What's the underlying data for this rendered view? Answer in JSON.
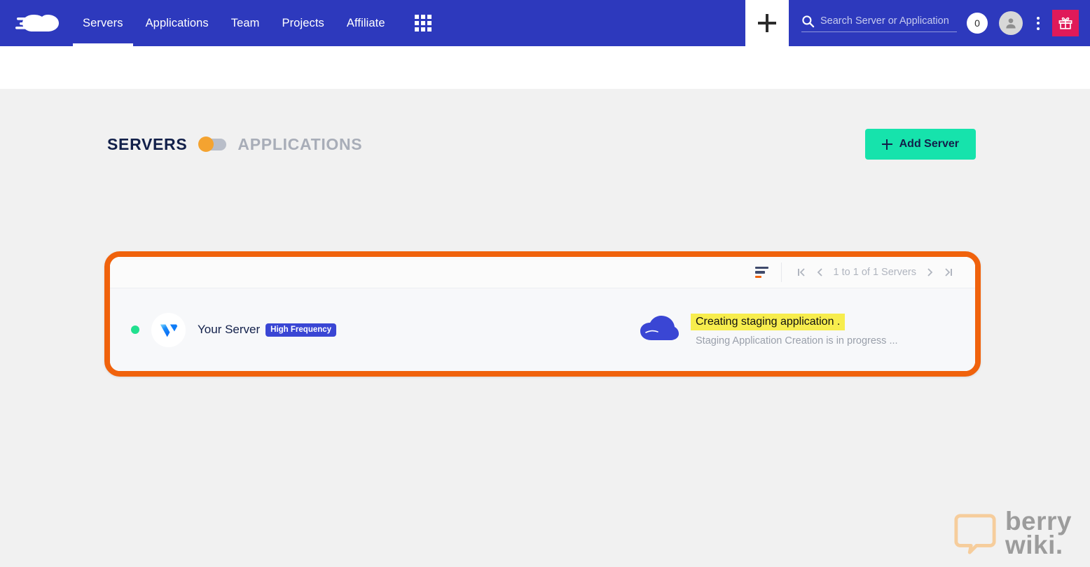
{
  "navbar": {
    "logo_name": "cloudways-logo",
    "links": [
      {
        "label": "Servers",
        "active": true
      },
      {
        "label": "Applications",
        "active": false
      },
      {
        "label": "Team",
        "active": false
      },
      {
        "label": "Projects",
        "active": false
      },
      {
        "label": "Affiliate",
        "active": false
      }
    ],
    "grid_icon": "apps-grid-icon",
    "plus_icon": "plus-icon",
    "search": {
      "placeholder": "Search Server or Application",
      "value": "",
      "icon": "search-icon"
    },
    "notification_count": "0",
    "avatar_icon": "user-avatar-icon",
    "kebab_icon": "more-vertical-icon",
    "gift_icon": "gift-icon",
    "colors": {
      "navbar_bg": "#2d39bd",
      "gift_bg": "#e01a59"
    }
  },
  "page": {
    "heading": {
      "servers_label": "SERVERS",
      "applications_label": "APPLICATIONS",
      "toggle_state": "servers"
    },
    "add_server_button": "Add Server",
    "card": {
      "toolbar": {
        "sort_icon": "sort-icon",
        "first_page_icon": "⟨|",
        "prev_page_icon": "‹",
        "pagination_text": "1 to 1 of 1 Servers",
        "next_page_icon": "›",
        "last_page_icon": "|⟩"
      },
      "row": {
        "status_dot_color": "#21e08f",
        "provider_logo": "vultr-logo",
        "server_name": "Your Server",
        "badge_label": "High Frequency",
        "cloud_icon": "cloud-icon",
        "status_main": "Creating staging application .",
        "status_sub": "Staging Application Creation is in progress ...",
        "highlight_color": "#f7ed4d"
      },
      "highlight_border_color": "#f0620c"
    }
  },
  "watermark": {
    "line1": "berry",
    "line2": "wiki.",
    "icon": "speech-bubble-icon"
  }
}
